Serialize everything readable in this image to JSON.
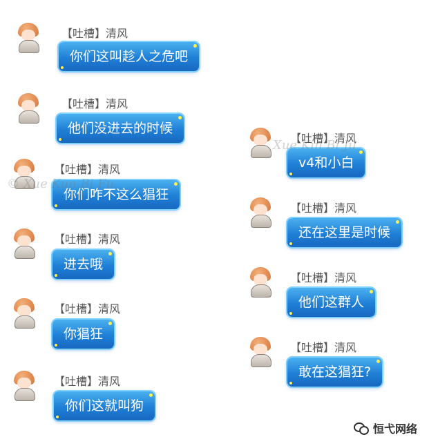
{
  "chat": {
    "left": [
      {
        "name": "【吐槽】清风",
        "text": "你们这叫趁人之危吧"
      },
      {
        "name": "【吐槽】清风",
        "text": "他们没进去的时候"
      },
      {
        "name": "【吐槽】清风",
        "text": "你们咋不这么猖狂"
      },
      {
        "name": "【吐槽】清风",
        "text": "进去哦"
      },
      {
        "name": "【吐槽】清风",
        "text": "你猖狂"
      },
      {
        "name": "【吐槽】清风",
        "text": "你们这就叫狗"
      }
    ],
    "right": [
      {
        "name": "【吐槽】清风",
        "text": "v4和小白"
      },
      {
        "name": "【吐槽】清风",
        "text": "还在这里是时候"
      },
      {
        "name": "【吐槽】清风",
        "text": "他们这群人"
      },
      {
        "name": "【吐槽】清风",
        "text": "敢在这猖狂?"
      }
    ]
  },
  "watermark": {
    "text1": "© Xue Kun Bi Fu",
    "text2": "Xue Kin Bi Ju"
  },
  "brand": {
    "label": "恒弋网络",
    "icon": "wechat-icon"
  }
}
